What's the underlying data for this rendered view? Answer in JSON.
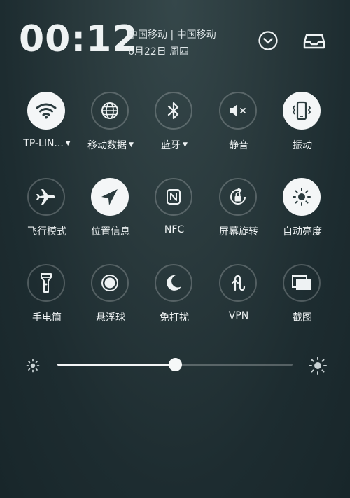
{
  "header": {
    "time": "00:12",
    "carrier": "中国移动 | 中国移动",
    "date": "6月22日 周四"
  },
  "tiles": [
    {
      "label": "TP-LIN...",
      "caret": "▼",
      "icon": "wifi-icon",
      "active": true
    },
    {
      "label": "移动数据",
      "caret": "▼",
      "icon": "globe-icon",
      "active": false
    },
    {
      "label": "蓝牙",
      "caret": "▼",
      "icon": "bluetooth-icon",
      "active": false
    },
    {
      "label": "静音",
      "caret": "",
      "icon": "mute-icon",
      "active": false
    },
    {
      "label": "振动",
      "caret": "",
      "icon": "vibrate-icon",
      "active": true
    },
    {
      "label": "飞行模式",
      "caret": "",
      "icon": "airplane-icon",
      "active": false
    },
    {
      "label": "位置信息",
      "caret": "",
      "icon": "location-icon",
      "active": true
    },
    {
      "label": "NFC",
      "caret": "",
      "icon": "nfc-icon",
      "active": false
    },
    {
      "label": "屏幕旋转",
      "caret": "",
      "icon": "rotation-lock-icon",
      "active": false
    },
    {
      "label": "自动亮度",
      "caret": "",
      "icon": "auto-brightness-icon",
      "active": true
    },
    {
      "label": "手电筒",
      "caret": "",
      "icon": "flashlight-icon",
      "active": false
    },
    {
      "label": "悬浮球",
      "caret": "",
      "icon": "floating-ball-icon",
      "active": false
    },
    {
      "label": "免打扰",
      "caret": "",
      "icon": "moon-icon",
      "active": false
    },
    {
      "label": "VPN",
      "caret": "",
      "icon": "vpn-icon",
      "active": false
    },
    {
      "label": "截图",
      "caret": "",
      "icon": "screenshot-icon",
      "active": false
    }
  ],
  "brightness": {
    "level": 0.5
  },
  "colors": {
    "active_tile": "#f4f6f7",
    "icon_dark": "#2b3b3e",
    "icon_light": "#eef2f3"
  }
}
